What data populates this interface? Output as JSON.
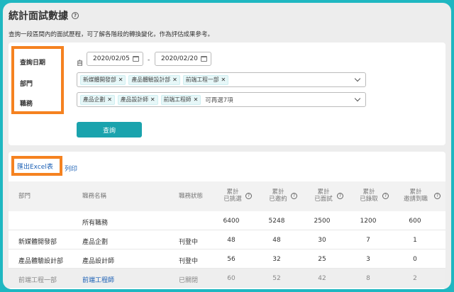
{
  "header": {
    "title": "統計面試數據",
    "subtitle": "查詢一段區間內的面試歷程，可了解各階段的轉換變化，作為評估成果參考。"
  },
  "filters": {
    "date_label": "查詢日期",
    "department_label": "部門",
    "position_label": "職務",
    "self_label": "自",
    "date_from": "2020/02/05",
    "date_separator": "-",
    "date_to": "2020/02/20",
    "departments": [
      "新媒體開發部",
      "產品體驗設計部",
      "前端工程一部"
    ],
    "positions": [
      "產品企劃",
      "產品設計師",
      "前端工程師"
    ],
    "positions_more": "可再選7項",
    "query_button": "查詢"
  },
  "results": {
    "export_link": "匯出Excel表",
    "print_link": "列印",
    "columns": {
      "department": "部門",
      "position": "職務名稱",
      "status": "職務狀態",
      "picked": [
        "累計",
        "已挑選"
      ],
      "invited": [
        "累計",
        "已邀約"
      ],
      "interviewed": [
        "累計",
        "已面試"
      ],
      "hired": [
        "累計",
        "已錄取"
      ],
      "onboard": [
        "累計",
        "邀請到職"
      ]
    },
    "rows": [
      {
        "department": "",
        "position": "所有職務",
        "status": "",
        "picked": "6400",
        "invited": "5248",
        "interviewed": "2500",
        "hired": "1200",
        "onboard": "600"
      },
      {
        "department": "新媒體開發部",
        "position": "產品企劃",
        "status": "刊登中",
        "picked": "48",
        "invited": "48",
        "interviewed": "30",
        "hired": "7",
        "onboard": "1"
      },
      {
        "department": "產品體驗設計部",
        "position": "產品設計師",
        "status": "刊登中",
        "picked": "56",
        "invited": "32",
        "interviewed": "25",
        "hired": "3",
        "onboard": "0"
      },
      {
        "department": "前端工程一部",
        "position": "前端工程師",
        "status": "已關閉",
        "picked": "60",
        "invited": "52",
        "interviewed": "42",
        "hired": "8",
        "onboard": "2"
      }
    ]
  },
  "colors": {
    "accent": "#1aa3ad",
    "highlight_border": "#f58220",
    "link": "#1a5fb4",
    "background_frame": "#1fb7c1"
  },
  "icons": {
    "help": "question-circle-icon",
    "calendar": "calendar-icon",
    "dropdown": "chevron-down-icon",
    "tag_remove": "close-icon"
  }
}
